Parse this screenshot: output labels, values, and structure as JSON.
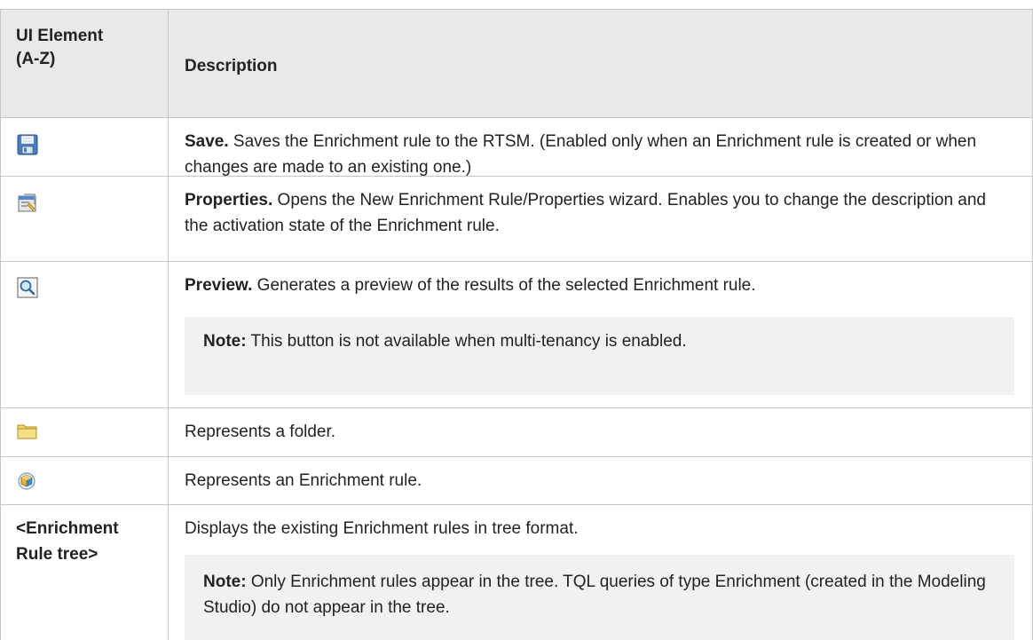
{
  "header": {
    "col1": "UI Element (A-Z)",
    "col1_line1": "UI Element",
    "col1_line2": "(A-Z)",
    "col2": "Description"
  },
  "rows": [
    {
      "icon": "save-icon",
      "term": "Save.",
      "text": " Saves the Enrichment rule to the RTSM. (Enabled only when an Enrichment rule is created or when changes are made to an existing one.)"
    },
    {
      "icon": "properties-icon",
      "term": "Properties.",
      "text": " Opens the New Enrichment Rule/Properties wizard. Enables you to change the description and the activation state of the Enrichment rule."
    },
    {
      "icon": "preview-icon",
      "term": "Preview.",
      "text": " Generates a preview of the results of the selected Enrichment rule.",
      "note_label": "Note:",
      "note_text": " This button is not available when multi-tenancy is enabled."
    },
    {
      "icon": "folder-icon",
      "text": "Represents a folder."
    },
    {
      "icon": "enrichment-rule-icon",
      "text": "Represents an Enrichment rule."
    },
    {
      "element": "<Enrichment Rule tree>",
      "element_line1": "<Enrichment",
      "element_line2": "Rule tree>",
      "text": "Displays the existing Enrichment rules in tree format.",
      "note_label": "Note:",
      "note_text": " Only Enrichment rules appear in the tree. TQL queries of type Enrichment (created in the Modeling Studio) do not appear in the tree."
    }
  ]
}
